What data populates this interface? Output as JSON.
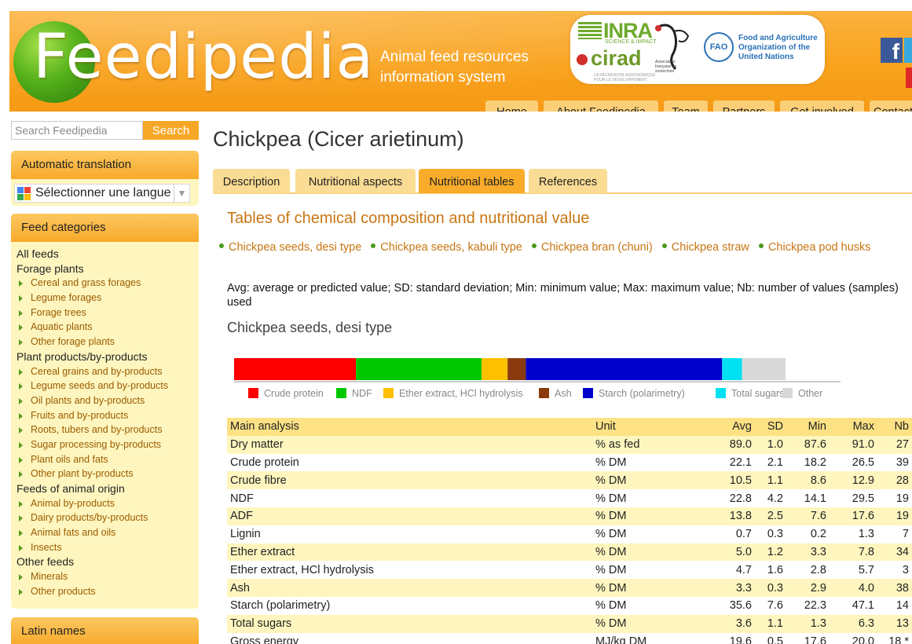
{
  "header": {
    "logo_text": "Feedipedia",
    "tagline": "Animal feed resources information system",
    "partners": {
      "inra": "INRA",
      "inra_sub": "SCIENCE & IMPACT",
      "cirad": "cirad",
      "cirad_sub": "LA RECHERCHE AGRONOMIQUE POUR LE DÉVELOPPEMENT",
      "asso": "Association française de zootechnie",
      "fao_badge": "FAO",
      "fao": "Food and Agriculture Organization of the United Nations"
    },
    "social": {
      "facebook": "f"
    },
    "nav": [
      "Home",
      "About Feedipedia",
      "Team",
      "Partners",
      "Get involved",
      "Contact"
    ]
  },
  "sidebar": {
    "search": {
      "placeholder": "Search Feedipedia",
      "button": "Search"
    },
    "translate": {
      "title": "Automatic translation",
      "select_label": "Sélectionner une langue"
    },
    "categories": {
      "title": "Feed categories",
      "groups": [
        {
          "label": "All feeds",
          "items": []
        },
        {
          "label": "Forage plants",
          "items": [
            "Cereal and grass forages",
            "Legume forages",
            "Forage trees",
            "Aquatic plants",
            "Other forage plants"
          ]
        },
        {
          "label": "Plant products/by-products",
          "items": [
            "Cereal grains and by-products",
            "Legume seeds and by-products",
            "Oil plants and by-products",
            "Fruits and by-products",
            "Roots, tubers and by-products",
            "Sugar processing by-products",
            "Plant oils and fats",
            "Other plant by-products"
          ]
        },
        {
          "label": "Feeds of animal origin",
          "items": [
            "Animal by-products",
            "Dairy products/by-products",
            "Animal fats and oils",
            "Insects"
          ]
        },
        {
          "label": "Other feeds",
          "items": [
            "Minerals",
            "Other products"
          ]
        }
      ]
    },
    "latin": {
      "title": "Latin names"
    }
  },
  "main": {
    "title": "Chickpea (Cicer arietinum)",
    "tabs": [
      {
        "label": "Description",
        "active": false
      },
      {
        "label": "Nutritional aspects",
        "active": false
      },
      {
        "label": "Nutritional tables",
        "active": true
      },
      {
        "label": "References",
        "active": false
      }
    ],
    "section_title": "Tables of chemical composition and nutritional value",
    "sublinks": [
      "Chickpea seeds, desi type",
      "Chickpea seeds, kabuli type",
      "Chickpea bran (chuni)",
      "Chickpea straw",
      "Chickpea pod husks"
    ],
    "legend_note": "Avg: average or predicted value; SD: standard deviation; Min: minimum value; Max: maximum value; Nb: number of values (samples) used",
    "sub_title": "Chickpea seeds, desi type"
  },
  "chart_data": {
    "type": "bar",
    "orientation": "horizontal-stacked",
    "unit": "% DM",
    "segments": [
      {
        "name": "Crude protein",
        "value": 22.1,
        "color": "#ff0000"
      },
      {
        "name": "NDF",
        "value": 22.8,
        "color": "#00c800"
      },
      {
        "name": "Ether extract, HCl hydrolysis",
        "value": 4.7,
        "color": "#ffc000"
      },
      {
        "name": "Ash",
        "value": 3.3,
        "color": "#8b3a0e"
      },
      {
        "name": "Starch (polarimetry)",
        "value": 35.6,
        "color": "#0000cc"
      },
      {
        "name": "Total sugars",
        "value": 3.6,
        "color": "#00e0f0"
      },
      {
        "name": "Other",
        "value": 7.9,
        "color": "#d8d8d8"
      }
    ],
    "legend_position": "bottom"
  },
  "table": {
    "headers": [
      "Main analysis",
      "Unit",
      "Avg",
      "SD",
      "Min",
      "Max",
      "Nb"
    ],
    "rows": [
      [
        "Dry matter",
        "% as fed",
        "89.0",
        "1.0",
        "87.6",
        "91.0",
        "27"
      ],
      [
        "Crude protein",
        "% DM",
        "22.1",
        "2.1",
        "18.2",
        "26.5",
        "39"
      ],
      [
        "Crude fibre",
        "% DM",
        "10.5",
        "1.1",
        "8.6",
        "12.9",
        "28"
      ],
      [
        "NDF",
        "% DM",
        "22.8",
        "4.2",
        "14.1",
        "29.5",
        "19"
      ],
      [
        "ADF",
        "% DM",
        "13.8",
        "2.5",
        "7.6",
        "17.6",
        "19"
      ],
      [
        "Lignin",
        "% DM",
        "0.7",
        "0.3",
        "0.2",
        "1.3",
        "7"
      ],
      [
        "Ether extract",
        "% DM",
        "5.0",
        "1.2",
        "3.3",
        "7.8",
        "34"
      ],
      [
        "Ether extract, HCl hydrolysis",
        "% DM",
        "4.7",
        "1.6",
        "2.8",
        "5.7",
        "3"
      ],
      [
        "Ash",
        "% DM",
        "3.3",
        "0.3",
        "2.9",
        "4.0",
        "38"
      ],
      [
        "Starch (polarimetry)",
        "% DM",
        "35.6",
        "7.6",
        "22.3",
        "47.1",
        "14"
      ],
      [
        "Total sugars",
        "% DM",
        "3.6",
        "1.1",
        "1.3",
        "6.3",
        "13"
      ],
      [
        "Gross energy",
        "MJ/kg DM",
        "19.6",
        "0.5",
        "17.6",
        "20.0",
        "18 *"
      ]
    ]
  }
}
